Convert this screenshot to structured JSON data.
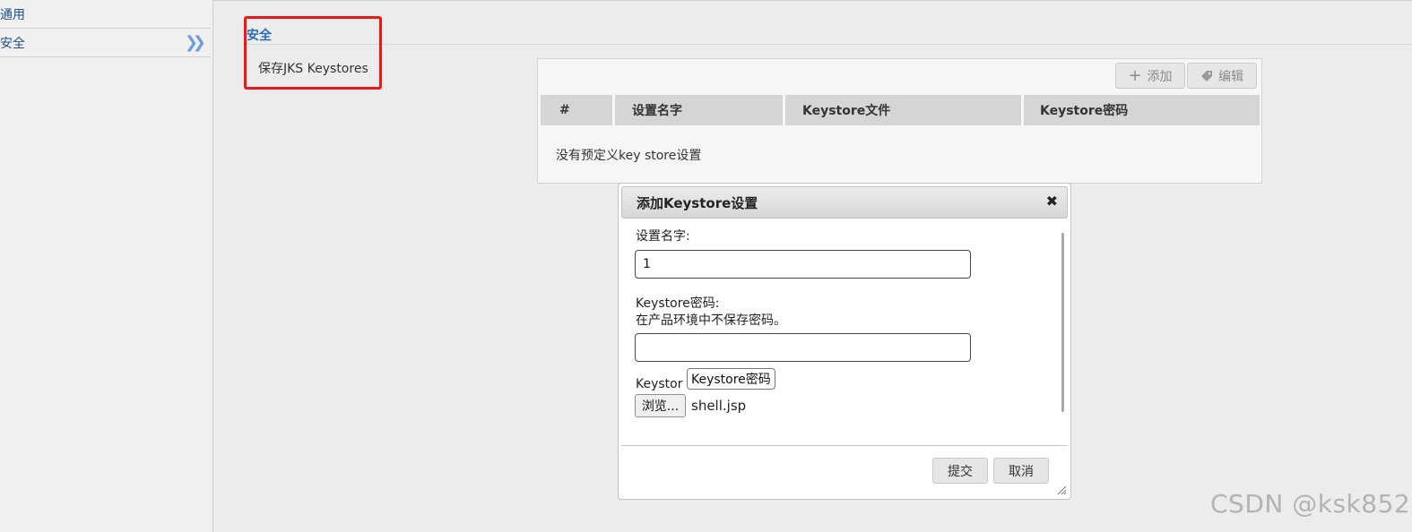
{
  "sidebar": {
    "items": [
      {
        "label": "通用"
      },
      {
        "label": "安全"
      }
    ]
  },
  "section": {
    "title": "安全",
    "subtitle": "保存JKS Keystores"
  },
  "toolbar": {
    "add_label": "添加",
    "edit_label": "编辑"
  },
  "table": {
    "columns": [
      "#",
      "设置名字",
      "Keystore文件",
      "Keystore密码"
    ],
    "empty_message": "没有预定义key store设置"
  },
  "dialog": {
    "title": "添加Keystore设置",
    "name_label": "设置名字:",
    "name_value": "1",
    "password_label": "Keystore密码:",
    "password_hint": "在产品环境中不保存密码。",
    "password_value": "",
    "file_label": "Keystor",
    "tooltip": "Keystore密码",
    "browse_label": "浏览...",
    "file_name": "shell.jsp",
    "submit_label": "提交",
    "cancel_label": "取消"
  },
  "watermark": "CSDN @ksk852",
  "colors": {
    "accent": "#2a6ab8",
    "highlight_box": "#e8191a",
    "header_bg": "#d5d5d5"
  }
}
